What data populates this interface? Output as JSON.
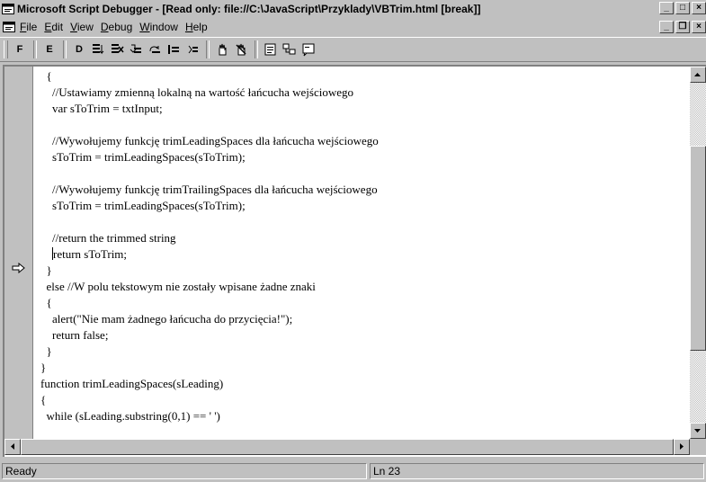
{
  "window": {
    "title": "Microsoft Script Debugger - [Read only: file://C:\\JavaScript\\Przyklady\\VBTrim.html [break]]",
    "controls": {
      "minimize": "_",
      "maximize": "□",
      "close": "×"
    }
  },
  "menubar": {
    "items": [
      "File",
      "Edit",
      "View",
      "Debug",
      "Window",
      "Help"
    ],
    "mdi_controls": {
      "minimize": "_",
      "restore": "❐",
      "close": "×"
    }
  },
  "toolbar": {
    "letters": [
      "F",
      "E",
      "D"
    ]
  },
  "editor": {
    "lines": [
      "  {",
      "    //Ustawiamy zmienną lokalną na wartość łańcucha wejściowego",
      "    var sToTrim = txtInput;",
      "",
      "    //Wywołujemy funkcję trimLeadingSpaces dla łańcucha wejściowego",
      "    sToTrim = trimLeadingSpaces(sToTrim);",
      "",
      "    //Wywołujemy funkcję trimTrailingSpaces dla łańcucha wejściowego",
      "    sToTrim = trimLeadingSpaces(sToTrim);",
      "",
      "    //return the trimmed string",
      "    return sToTrim;",
      "  }",
      "  else //W polu tekstowym nie zostały wpisane żadne znaki",
      "  {",
      "    alert(\"Nie mam żadnego łańcucha do przycięcia!\");",
      "    return false;",
      "  }",
      "}",
      "function trimLeadingSpaces(sLeading)",
      "{",
      "  while (sLeading.substring(0,1) == ' ')"
    ],
    "current_line_index": 11,
    "current_line_indent": "    "
  },
  "statusbar": {
    "text": "Ready",
    "line": "Ln 23"
  },
  "colors": {
    "chrome": "#c0c0c0",
    "editor_bg": "#ffffff"
  }
}
